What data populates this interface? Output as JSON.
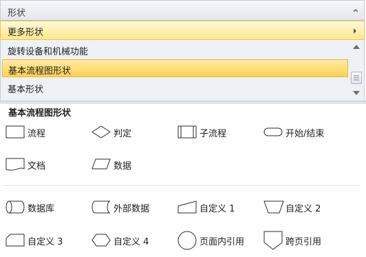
{
  "panel": {
    "title": "形状",
    "more_shapes": "更多形状"
  },
  "stencils": [
    {
      "label": "旋转设备和机械功能",
      "selected": false
    },
    {
      "label": "基本流程图形状",
      "selected": true
    },
    {
      "label": "基本形状",
      "selected": false
    }
  ],
  "section": {
    "title": "基本流程图形状"
  },
  "shapes": [
    {
      "label": "流程",
      "icon": "process-icon"
    },
    {
      "label": "判定",
      "icon": "decision-icon"
    },
    {
      "label": "子流程",
      "icon": "subprocess-icon"
    },
    {
      "label": "开始/结束",
      "icon": "start-end-icon"
    },
    {
      "label": "文档",
      "icon": "document-icon"
    },
    {
      "label": "数据",
      "icon": "data-icon"
    },
    {
      "label": "数据库",
      "icon": "database-icon"
    },
    {
      "label": "外部数据",
      "icon": "external-data-icon"
    },
    {
      "label": "自定义 1",
      "icon": "custom-1-icon"
    },
    {
      "label": "自定义 2",
      "icon": "custom-2-icon"
    },
    {
      "label": "自定义 3",
      "icon": "custom-3-icon"
    },
    {
      "label": "自定义 4",
      "icon": "custom-4-icon"
    },
    {
      "label": "页面内引用",
      "icon": "on-page-reference-icon"
    },
    {
      "label": "跨页引用",
      "icon": "off-page-reference-icon"
    }
  ],
  "colors": {
    "selected_highlight": "#ffd24f",
    "header_bg": "#e3e7ee",
    "shape_stroke": "#2a2a2a"
  }
}
